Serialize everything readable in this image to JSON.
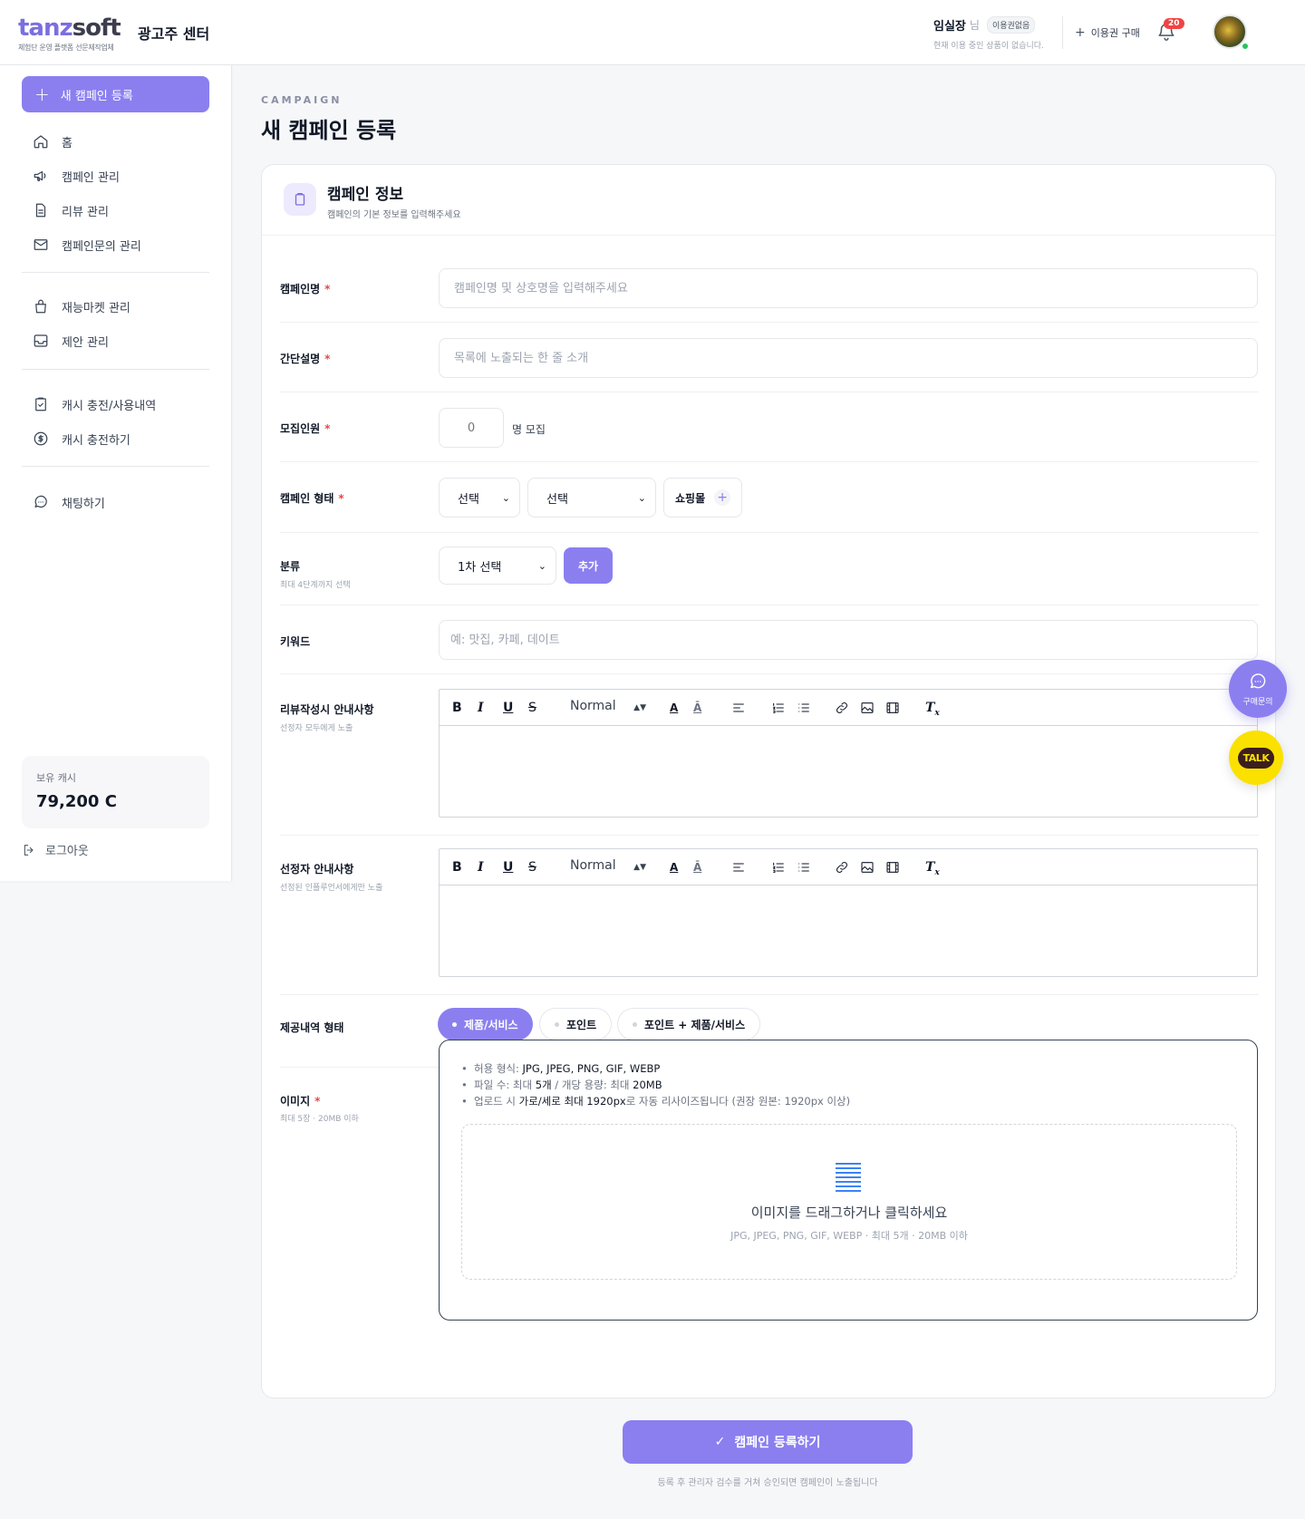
{
  "header": {
    "logo_part1": "tanz",
    "logo_part2": "soft",
    "logo_tagline": "체험단 운영 플랫폼 선문제작업체",
    "center_title": "광고주 센터",
    "user_name": "임실장",
    "user_suffix": "님",
    "plan_badge": "이용권없음",
    "plan_status": "현재 이용 중인 상품이 없습니다.",
    "buy_pass_label": "이용권 구매",
    "notification_count": "20"
  },
  "sidebar": {
    "new_campaign_label": "새 캠페인 등록",
    "items": [
      {
        "label": "홈",
        "icon": "home-icon"
      },
      {
        "label": "캠페인 관리",
        "icon": "megaphone-icon"
      },
      {
        "label": "리뷰 관리",
        "icon": "document-icon"
      },
      {
        "label": "캠페인문의 관리",
        "icon": "mail-icon"
      },
      {
        "label": "재능마켓 관리",
        "icon": "bag-icon"
      },
      {
        "label": "제안 관리",
        "icon": "inbox-icon"
      },
      {
        "label": "캐시 충전/사용내역",
        "icon": "clipboard-check-icon"
      },
      {
        "label": "캐시 충전하기",
        "icon": "dollar-icon"
      },
      {
        "label": "채팅하기",
        "icon": "chat-icon"
      }
    ],
    "cash_label": "보유 캐시",
    "cash_value": "79,200 C",
    "logout_label": "로그아웃"
  },
  "page": {
    "eyebrow": "CAMPAIGN",
    "title": "새 캠페인 등록"
  },
  "card": {
    "title": "캠페인 정보",
    "subtitle": "캠페인의 기본 정보를 입력해주세요"
  },
  "form": {
    "campaign_name": {
      "label": "캠페인명",
      "placeholder": "캠페인명 및 상호명을 입력해주세요"
    },
    "short_desc": {
      "label": "간단설명",
      "placeholder": "목록에 노출되는 한 줄 소개"
    },
    "recruit": {
      "label": "모집인원",
      "value": "0",
      "suffix": "명 모집"
    },
    "campaign_type": {
      "label": "캠페인 형태",
      "select1": "선택",
      "select2": "선택",
      "shop_chip": "쇼핑몰"
    },
    "category": {
      "label": "분류",
      "sublabel": "최대 4단계까지 선택",
      "select": "1차 선택",
      "add_label": "추가"
    },
    "keyword": {
      "label": "키워드",
      "placeholder": "예: 맛집, 카페, 데이트"
    },
    "review_guide": {
      "label": "리뷰작성시 안내사항",
      "sublabel": "선정자 모두에게 노출",
      "format": "Normal"
    },
    "selected_guide": {
      "label": "선정자 안내사항",
      "sublabel": "선정된 인플루언서에게만 노출",
      "format": "Normal"
    },
    "offer_type": {
      "label": "제공내역 형태",
      "options": [
        "제품/서비스",
        "포인트",
        "포인트 + 제품/서비스"
      ],
      "selected": "제품/서비스"
    },
    "image": {
      "label": "이미지",
      "sublabel": "최대 5장 · 20MB 이하",
      "rule1_prefix": "허용 형식: ",
      "rule1_value": "JPG, JPEG, PNG, GIF, WEBP",
      "rule2_prefix": "파일 수: 최대 ",
      "rule2_count": "5개",
      "rule2_mid": " / 개당 용량: 최대 ",
      "rule2_size": "20MB",
      "rule3_prefix": "업로드 시 ",
      "rule3_bold": "가로/세로 최대 1920px",
      "rule3_suffix": "로 자동 리사이즈됩니다 (권장 원본: 1920px 이상)",
      "drop_title": "이미지를 드래그하거나 클릭하세요",
      "drop_sub": "JPG, JPEG, PNG, GIF, WEBP · 최대 5개 · 20MB 이하"
    }
  },
  "submit": {
    "label": "캠페인 등록하기",
    "note": "등록 후 관리자 검수를 거쳐 승인되면 캠페인이 노출됩니다"
  },
  "floating": {
    "chat_label": "구매문의",
    "talk_label": "TALK"
  },
  "colors": {
    "accent": "#8b7ff0",
    "required": "#ef4444",
    "kakao": "#fae100"
  }
}
